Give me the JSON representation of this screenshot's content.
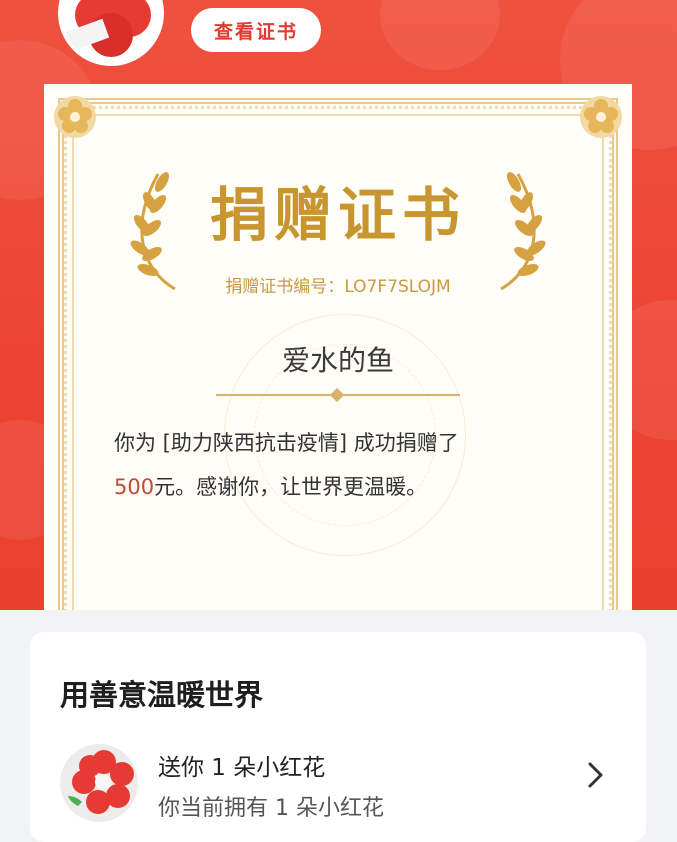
{
  "header": {
    "view_certificate_label": "查看证书"
  },
  "certificate": {
    "title": "捐赠证书",
    "number_label": "捐赠证书编号：",
    "number_value": "LO7F7SLOJM",
    "donor_name": "爱水的鱼",
    "message_line1": "你为 [助力陕西抗击疫情] 成功捐赠了",
    "amount": "500",
    "message_line2_rest": "元。感谢你，让世界更温暖。"
  },
  "card": {
    "title": "用善意温暖世界",
    "item_title": "送你 1 朵小红花",
    "item_subtitle": "你当前拥有 1 朵小红花"
  },
  "colors": {
    "hero_red": "#ec4434",
    "gold": "#c8952e",
    "amount_red": "#c24a33"
  },
  "icons": {
    "avatar": "red-flower-avatar",
    "laurel_left": "laurel-icon",
    "laurel_right": "laurel-icon",
    "corner": "flower-ornament-icon",
    "flower": "little-red-flower-icon",
    "chevron": "chevron-right-icon"
  }
}
